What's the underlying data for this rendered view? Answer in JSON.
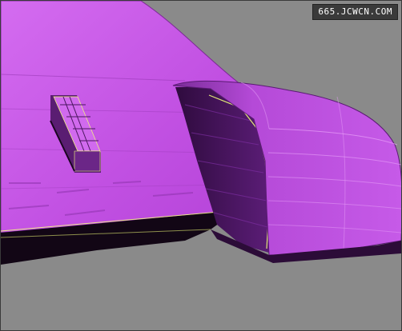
{
  "viewport": {
    "background_color": "#8a8a8a",
    "model_color": "#c24fe0",
    "model_highlight": "#d96cf0",
    "model_shadow": "#3a0d4a",
    "wire_color": "#f2ff7a"
  },
  "watermark": {
    "text": "665.JCWCN.COM"
  }
}
